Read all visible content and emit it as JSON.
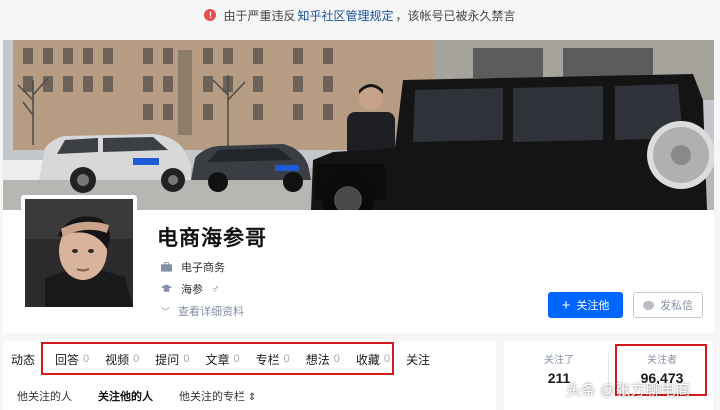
{
  "notice": {
    "icon": "alert-icon",
    "icon_glyph": "!",
    "prefix": "由于严重违反",
    "link": "知乎社区管理规定",
    "suffix": "，该帐号已被永久禁言"
  },
  "profile": {
    "name": "电商海参哥",
    "industry": "电子商务",
    "school": "海参",
    "gender_glyph": "♂",
    "details_link": "查看详细资料",
    "follow_button": "关注他",
    "message_button": "发私信"
  },
  "tabs": [
    {
      "label": "动态",
      "count": ""
    },
    {
      "label": "回答",
      "count": "0"
    },
    {
      "label": "视频",
      "count": "0"
    },
    {
      "label": "提问",
      "count": "0"
    },
    {
      "label": "文章",
      "count": "0"
    },
    {
      "label": "专栏",
      "count": "0"
    },
    {
      "label": "想法",
      "count": "0"
    },
    {
      "label": "收藏",
      "count": "0"
    },
    {
      "label": "关注",
      "count": ""
    }
  ],
  "subtabs": [
    "他关注的人",
    "关注他的人",
    "他关注的专栏"
  ],
  "stats": {
    "following_label": "关注了",
    "following_value": "211",
    "followers_label": "关注者",
    "followers_value": "96,473"
  },
  "watermark": "头条 @张方聊电商",
  "colors": {
    "accent": "#0066ff",
    "alert": "#e6504f",
    "highlight_box": "#d41a1a"
  }
}
